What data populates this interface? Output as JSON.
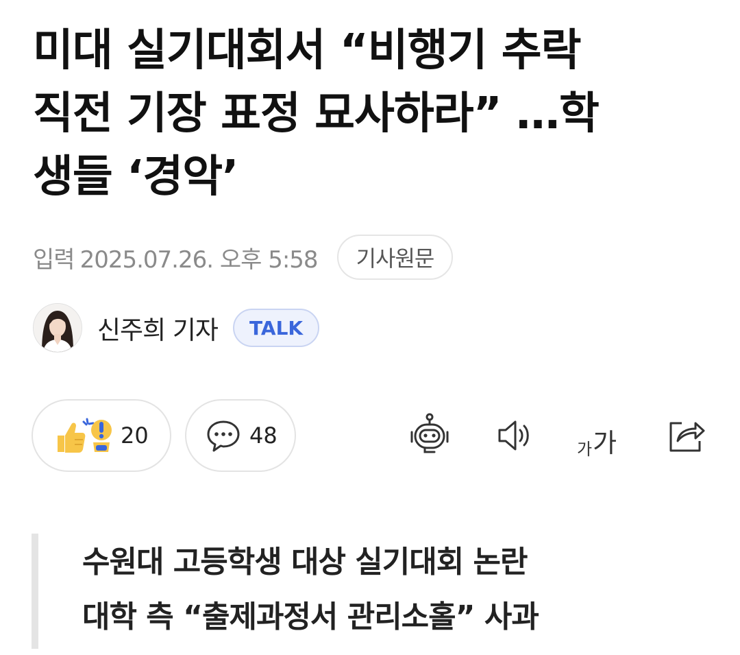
{
  "article": {
    "headline_lines": [
      "미대 실기대회서 “비행기 추락",
      "직전 기장 표정 묘사하라” …학",
      "생들 ‘경악’"
    ],
    "input_label": "입력",
    "input_datetime": "2025.07.26. 오후 5:58",
    "source_button": "기사원문"
  },
  "author": {
    "name": "신주희 기자",
    "talk_label": "TALK"
  },
  "reactions": {
    "like_count": "20",
    "comment_count": "48"
  },
  "toolbar": {
    "icons": [
      "robot-icon",
      "speaker-icon",
      "font-size-icon",
      "share-icon"
    ],
    "font_small": "가",
    "font_large": "가"
  },
  "summary": {
    "lines": [
      "수원대 고등학생 대상 실기대회 논란",
      "대학 측 “출제과정서 관리소홀” 사과"
    ]
  },
  "colors": {
    "text": "#111111",
    "meta": "#8a8a8a",
    "talk_accent": "#3a66db",
    "like_yellow": "#f7c548",
    "border": "#e3e3e3"
  }
}
